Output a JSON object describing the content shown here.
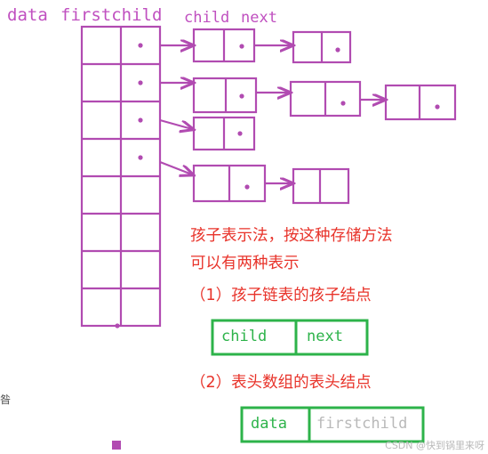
{
  "colors": {
    "purple": "#b14bb1",
    "red": "#e8332a",
    "green": "#2db34a",
    "watermark": "#b9b9b9"
  },
  "labels": {
    "data": "data",
    "firstchild": "firstchild",
    "child": "child",
    "next": "next"
  },
  "annotations": {
    "line1": "孩子表示法，按这种存储方法",
    "line2": "可以有两种表示",
    "line3": "（1）孩子链表的孩子结点",
    "line4": "（2）表头数组的表头结点"
  },
  "child_node_box": {
    "left_label": "child",
    "right_label": "next"
  },
  "header_node_box": {
    "left_label": "data",
    "right_label": "firstchild"
  },
  "watermark": "CSDN @快到锅里来呀",
  "left_fragment": "昝",
  "chart_data": {
    "type": "diagram",
    "title": "孩子表示法 (Child representation of a tree)",
    "array_rows": 8,
    "array_columns": [
      "data",
      "firstchild"
    ],
    "linked_lists": [
      {
        "row": 0,
        "nodes": 2
      },
      {
        "row": 1,
        "nodes": 3
      },
      {
        "row": 2,
        "nodes": 1
      },
      {
        "row": 3,
        "nodes": 2
      }
    ]
  }
}
